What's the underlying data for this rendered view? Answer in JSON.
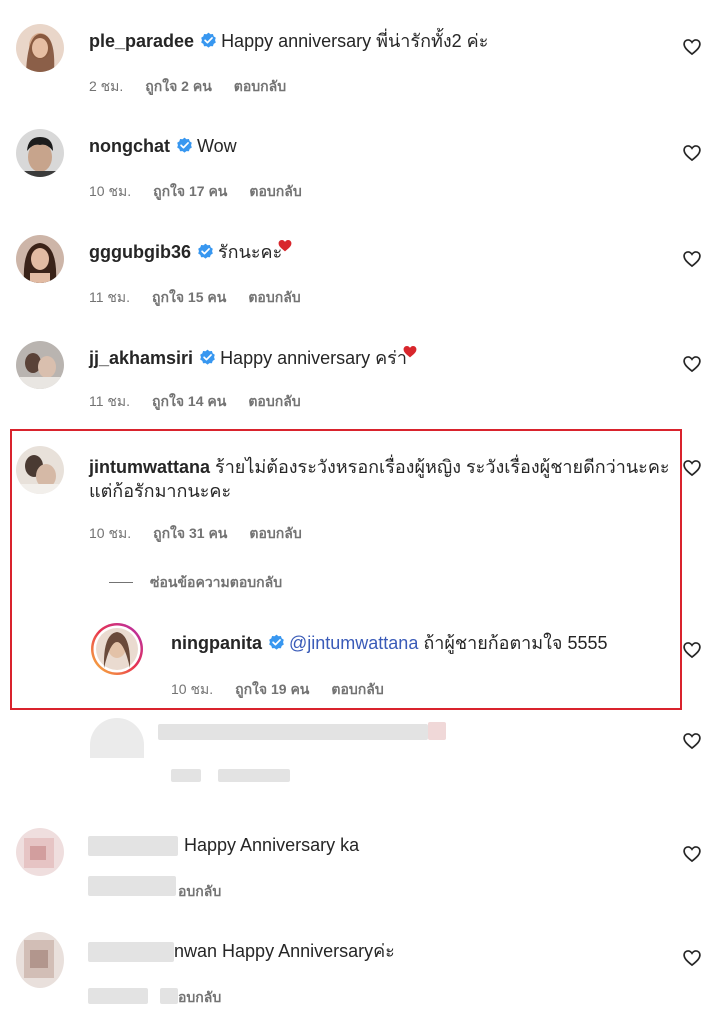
{
  "colors": {
    "verified": "#3897f0",
    "heart_outline": "#262626",
    "highlight_border": "#d9232d",
    "mention": "#3a5bb8",
    "meta": "#737373"
  },
  "comments": [
    {
      "username": "ple_paradee",
      "text": "Happy anniversary พี่น่ารักทั้ง2 ค่ะ",
      "time": "2 ชม.",
      "likes": "ถูกใจ 2 คน",
      "reply": "ตอบกลับ"
    },
    {
      "username": "nongchat",
      "text": "Wow",
      "time": "10 ชม.",
      "likes": "ถูกใจ 17 คน",
      "reply": "ตอบกลับ"
    },
    {
      "username": "gggubgib36",
      "text": "รักนะคะ",
      "time": "11 ชม.",
      "likes": "ถูกใจ 15 คน",
      "reply": "ตอบกลับ"
    },
    {
      "username": "jj_akhamsiri",
      "text": "Happy anniversary คร่า",
      "time": "11 ชม.",
      "likes": "ถูกใจ 14 คน",
      "reply": "ตอบกลับ"
    },
    {
      "username": "jintumwattana",
      "text_line1": "ร้ายไม่ต้องระวังหรอกเรื่องผู้หญิง ระวังเรื่องผู้ชายดีกว่านะคะ",
      "text_line2": "แต่ก้อรักมากนะคะ",
      "time": "10 ชม.",
      "likes": "ถูกใจ 31 คน",
      "reply": "ตอบกลับ",
      "hide_replies": "ซ่อนข้อความตอบกลับ"
    },
    {
      "username": "ningpanita",
      "mention": "@jintumwattana",
      "text": " ถ้าผู้ชายก้อตามใจ 5555",
      "time": "10 ชม.",
      "likes": "ถูกใจ 19 คน",
      "reply": "ตอบกลับ"
    },
    {
      "text": "Happy Anniversary ka",
      "reply": "อบกลับ"
    },
    {
      "username_fragment": "nwan",
      "text": " Happy Anniversaryค่ะ",
      "reply": "อบกลับ"
    }
  ],
  "icons": {
    "heart": "heart-outline-icon",
    "verified": "verified-badge-icon"
  }
}
